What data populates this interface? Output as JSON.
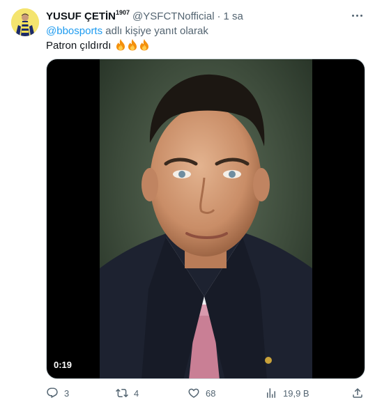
{
  "tweet": {
    "author_name": "YUSUF ÇETİN",
    "author_suffix": "1907",
    "handle": "@YSFCTNofficial",
    "separator": "·",
    "time": "1 sa",
    "reply_prefix": "@bbosports",
    "reply_suffix": " adlı kişiye yanıt olarak",
    "text": "Patron çıldırdı",
    "emoji": "fire-emoji",
    "video_duration": "0:19"
  },
  "actions": {
    "reply_count": "3",
    "retweet_count": "4",
    "like_count": "68",
    "views_count": "19,9 B"
  },
  "icons": {
    "reply": "comment-icon",
    "retweet": "retweet-icon",
    "like": "heart-icon",
    "views": "bar-chart-icon",
    "share": "share-icon",
    "more": "more-options-icon"
  },
  "colors": {
    "link": "#1d9bf0",
    "secondary_text": "#536471",
    "primary_text": "#0f1419"
  }
}
